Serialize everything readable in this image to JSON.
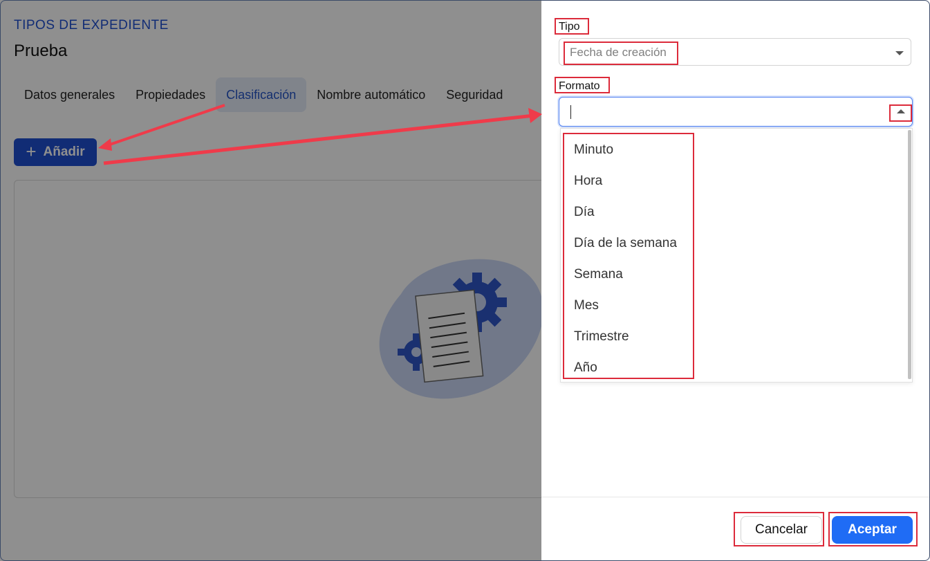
{
  "breadcrumb": "TIPOS DE EXPEDIENTE",
  "page_title": "Prueba",
  "tabs": [
    {
      "label": "Datos generales"
    },
    {
      "label": "Propiedades"
    },
    {
      "label": "Clasificación"
    },
    {
      "label": "Nombre automático"
    },
    {
      "label": "Seguridad"
    }
  ],
  "active_tab": "Clasificación",
  "add_button": {
    "icon": "plus-icon",
    "label": "Añadir"
  },
  "drawer": {
    "tipo": {
      "label": "Tipo",
      "value": "Fecha de creación"
    },
    "formato": {
      "label": "Formato",
      "value": "",
      "options": [
        "Minuto",
        "Hora",
        "Día",
        "Día de la semana",
        "Semana",
        "Mes",
        "Trimestre",
        "Año"
      ]
    },
    "cancel_label": "Cancelar",
    "accept_label": "Aceptar"
  },
  "colors": {
    "primary": "#1f4fd1",
    "accept": "#1f6cf5",
    "annotation": "#dc2a3a",
    "overlay": "rgba(0,0,0,0.44)"
  }
}
